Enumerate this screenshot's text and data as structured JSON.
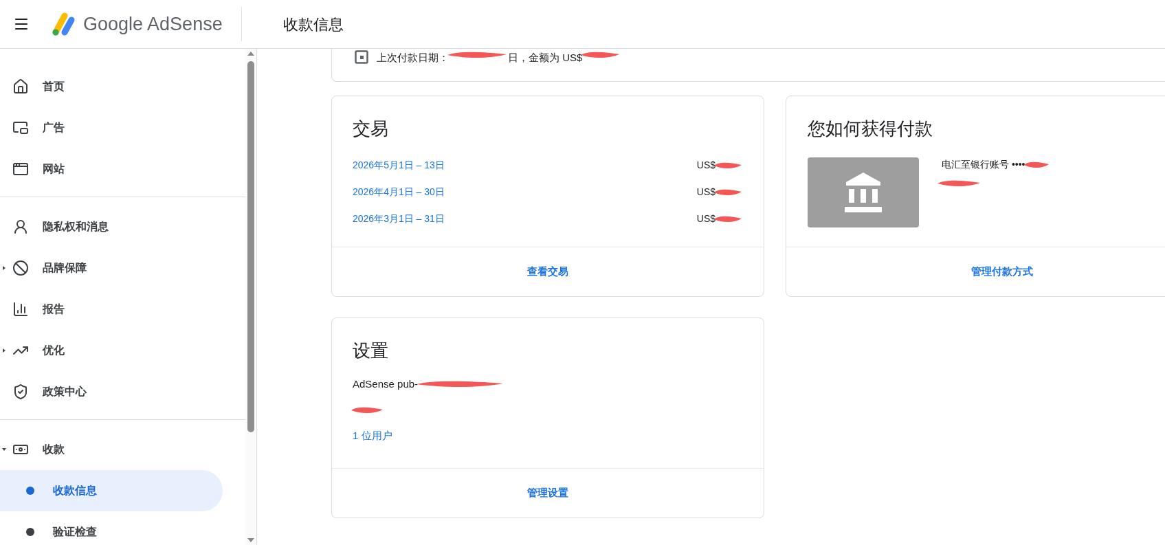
{
  "header": {
    "brand": "Google AdSense",
    "title": "收款信息"
  },
  "sidebar": {
    "groups": [
      {
        "items": [
          {
            "label": "首页",
            "kind": "link"
          },
          {
            "label": "广告",
            "kind": "link"
          },
          {
            "label": "网站",
            "kind": "link"
          }
        ]
      },
      {
        "items": [
          {
            "label": "隐私权和消息",
            "kind": "link"
          },
          {
            "label": "品牌保障",
            "kind": "expandable",
            "expanded": false
          },
          {
            "label": "报告",
            "kind": "link"
          },
          {
            "label": "优化",
            "kind": "expandable",
            "expanded": false
          },
          {
            "label": "政策中心",
            "kind": "link"
          }
        ]
      },
      {
        "items": [
          {
            "label": "收款",
            "kind": "expandable",
            "expanded": true,
            "children": [
              {
                "label": "收款信息",
                "selected": true
              },
              {
                "label": "验证检查",
                "selected": false
              }
            ]
          }
        ]
      }
    ]
  },
  "last_payment": {
    "label": "上次付款日期：",
    "suffix": "日，金额为 US$"
  },
  "transactions": {
    "title": "交易",
    "rows": [
      {
        "period": "2026年5月1日 – 13日",
        "amount": "US$"
      },
      {
        "period": "2026年4月1日 – 30日",
        "amount": "US$"
      },
      {
        "period": "2026年3月1日 – 31日",
        "amount": "US$"
      }
    ],
    "action": "查看交易"
  },
  "payment_method": {
    "title": "您如何获得付款",
    "method": "电汇至银行账号 ••••",
    "action": "管理付款方式"
  },
  "settings": {
    "title": "设置",
    "publisher": "AdSense pub-",
    "users": "1 位用户",
    "action": "管理设置"
  }
}
